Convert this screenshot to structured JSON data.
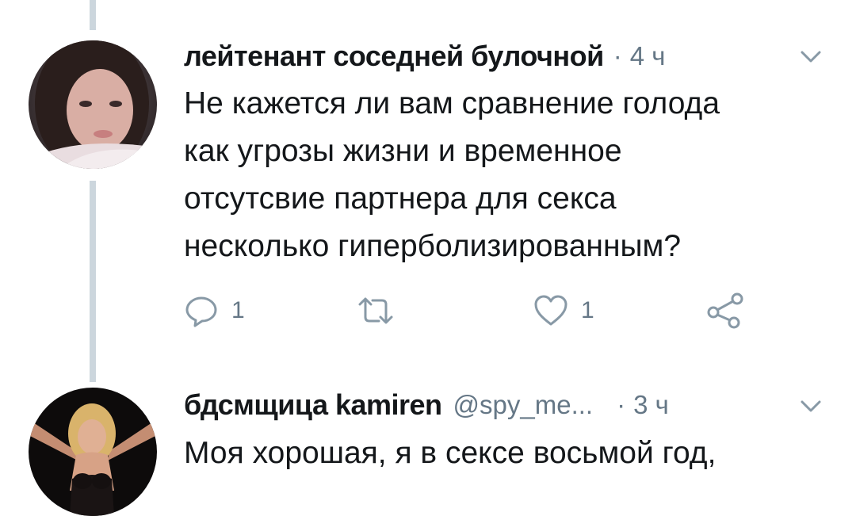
{
  "tweets": [
    {
      "author": "лейтенант соседней булочной",
      "handle": "",
      "separator": "·",
      "time": "4 ч",
      "text": "Не кажется ли вам сравнение голода\nкак угрозы жизни и временное\nотсутсвие партнера для секса\nнесколько гиперболизированным?",
      "avatar_icon": "user-avatar",
      "actions": {
        "reply_count": "1",
        "retweet_count": "",
        "like_count": "1"
      }
    },
    {
      "author": "бдсмщица kamiren",
      "handle": "@spy_me...",
      "separator": "·",
      "time": "3 ч",
      "text": "Моя хорошая, я в сексе восьмой год,",
      "avatar_icon": "user-avatar"
    }
  ],
  "icons": {
    "reply": "reply-icon",
    "retweet": "retweet-icon",
    "like": "like-icon",
    "share": "share-icon",
    "caret": "chevron-down-icon"
  },
  "colors": {
    "text_primary": "#14171a",
    "text_secondary": "#657786",
    "thread_line": "#ccd6dd",
    "background": "#ffffff"
  }
}
